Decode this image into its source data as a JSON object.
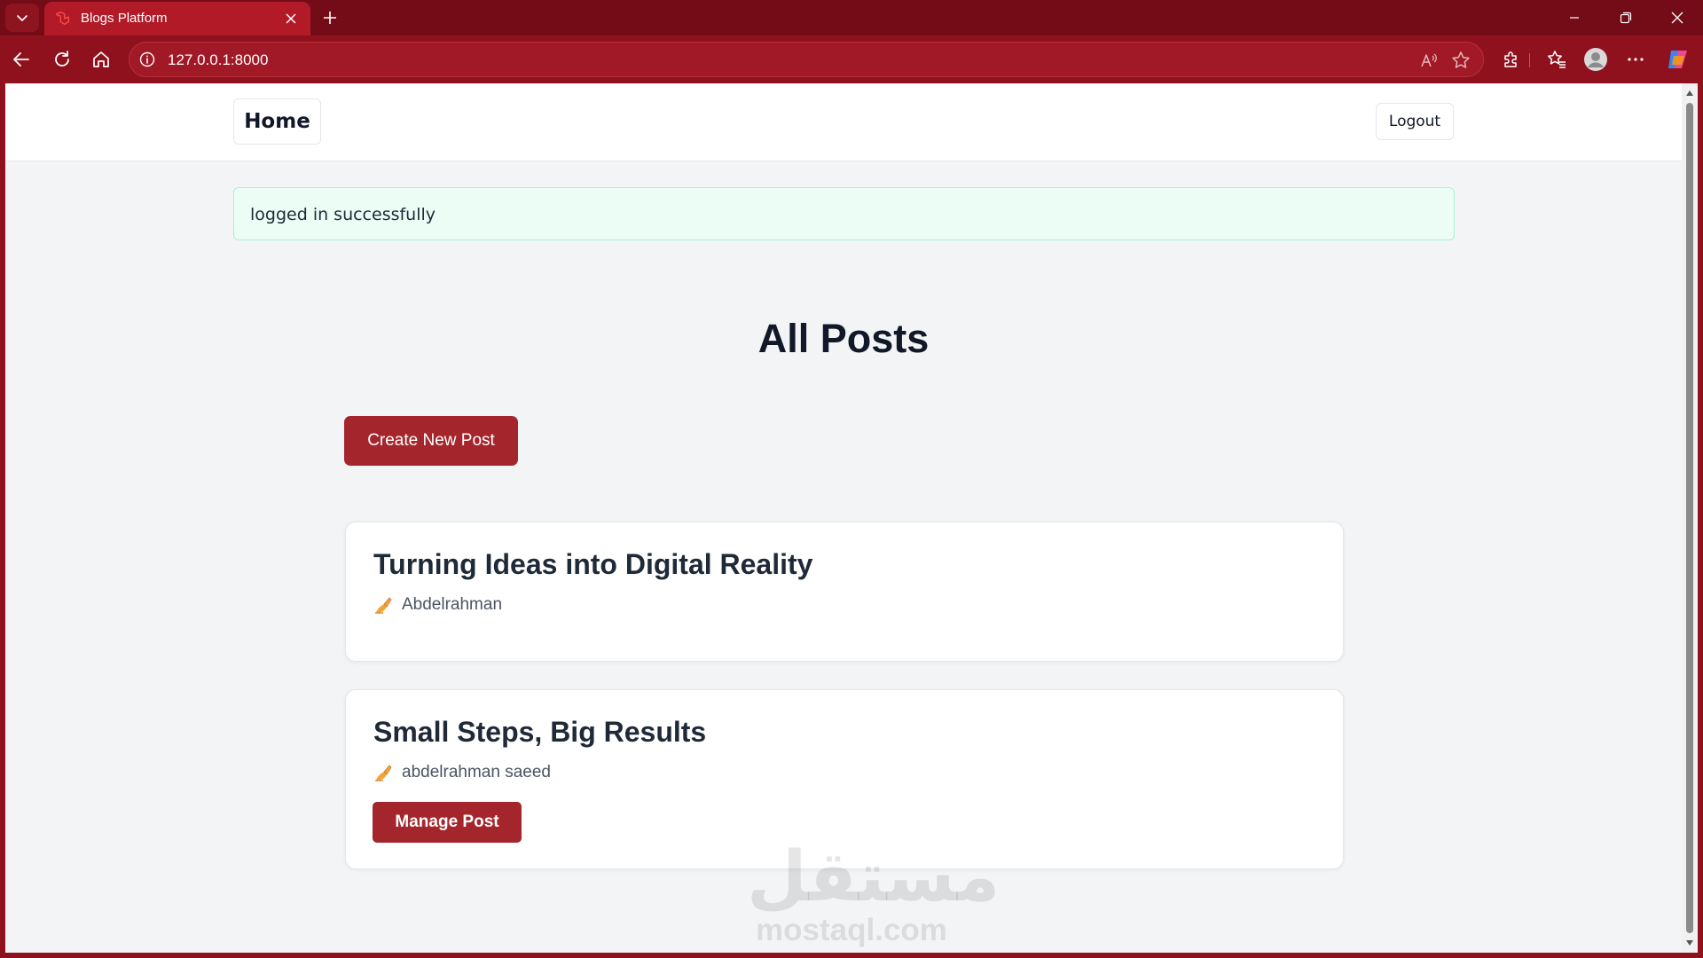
{
  "browser": {
    "tab_title": "Blogs Platform",
    "url": "127.0.0.1:8000",
    "accent": "#8f111d"
  },
  "nav": {
    "home_label": "Home",
    "logout_label": "Logout"
  },
  "alert": {
    "message": "logged in successfully"
  },
  "main": {
    "title": "All Posts",
    "create_label": "Create New Post"
  },
  "posts": [
    {
      "title": "Turning Ideas into Digital Reality",
      "author": "Abdelrahman",
      "icon": "writing-hand-icon"
    },
    {
      "title": "Small Steps, Big Results",
      "author": "abdelrahman saeed",
      "icon": "writing-hand-icon",
      "manage_label": "Manage Post"
    }
  ],
  "watermark": {
    "arabic": "مستقل",
    "latin": "mostaql.com"
  },
  "colors": {
    "primary_button": "#a4262c",
    "alert_background": "#ecfdf5",
    "alert_border": "#a7f3d0"
  }
}
